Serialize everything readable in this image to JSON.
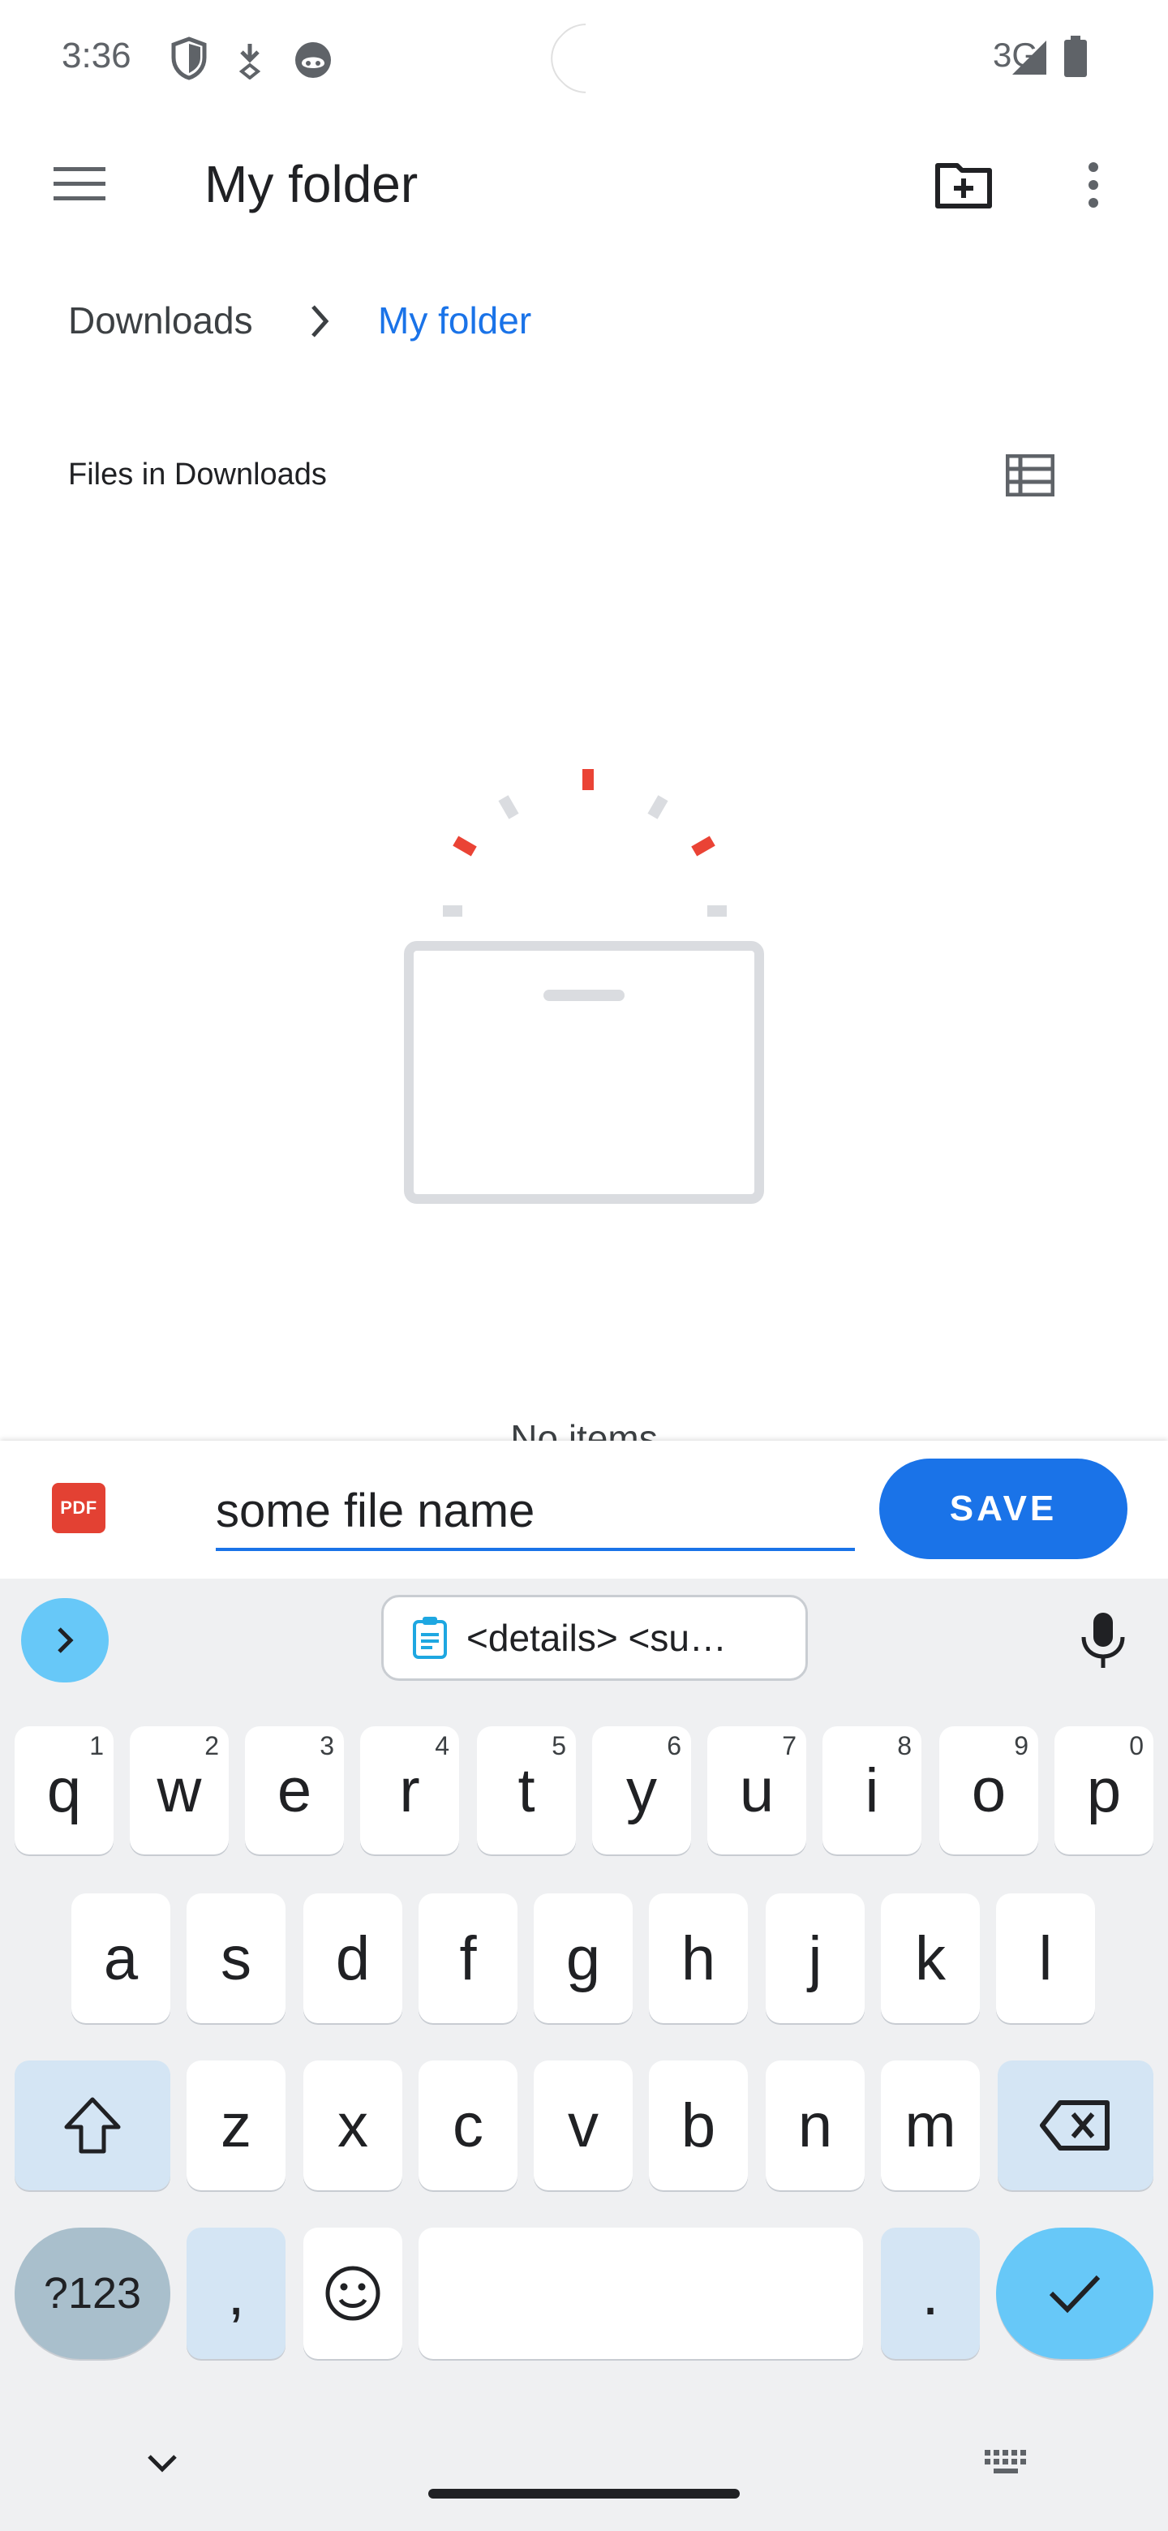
{
  "status_bar": {
    "time": "3:36",
    "network": "3G",
    "icons": [
      "shield-icon",
      "download-icon",
      "cat-icon",
      "signal-icon",
      "battery-icon"
    ]
  },
  "app_bar": {
    "title": "My folder",
    "icons": [
      "menu-icon",
      "new-folder-icon",
      "more-icon"
    ]
  },
  "breadcrumb": {
    "root": "Downloads",
    "current": "My folder"
  },
  "section_title": "Files in Downloads",
  "empty_state": {
    "text": "No items"
  },
  "save_bar": {
    "file_type": "PDF",
    "filename_value": "some file name",
    "save_label": "SAVE"
  },
  "keyboard": {
    "clipboard_suggestion": "<details>   <su…",
    "row1": [
      {
        "key": "q",
        "hint": "1"
      },
      {
        "key": "w",
        "hint": "2"
      },
      {
        "key": "e",
        "hint": "3"
      },
      {
        "key": "r",
        "hint": "4"
      },
      {
        "key": "t",
        "hint": "5"
      },
      {
        "key": "y",
        "hint": "6"
      },
      {
        "key": "u",
        "hint": "7"
      },
      {
        "key": "i",
        "hint": "8"
      },
      {
        "key": "o",
        "hint": "9"
      },
      {
        "key": "p",
        "hint": "0"
      }
    ],
    "row2": [
      "a",
      "s",
      "d",
      "f",
      "g",
      "h",
      "j",
      "k",
      "l"
    ],
    "row3": [
      "z",
      "x",
      "c",
      "v",
      "b",
      "n",
      "m"
    ],
    "symbols_label": "?123",
    "comma": ",",
    "period": "."
  },
  "colors": {
    "accent": "#1a73e8",
    "pdf_red": "#e34133",
    "keyboard_bg": "#eff0f2",
    "function_key": "#d4e5f4",
    "action_key": "#67c8f8"
  }
}
